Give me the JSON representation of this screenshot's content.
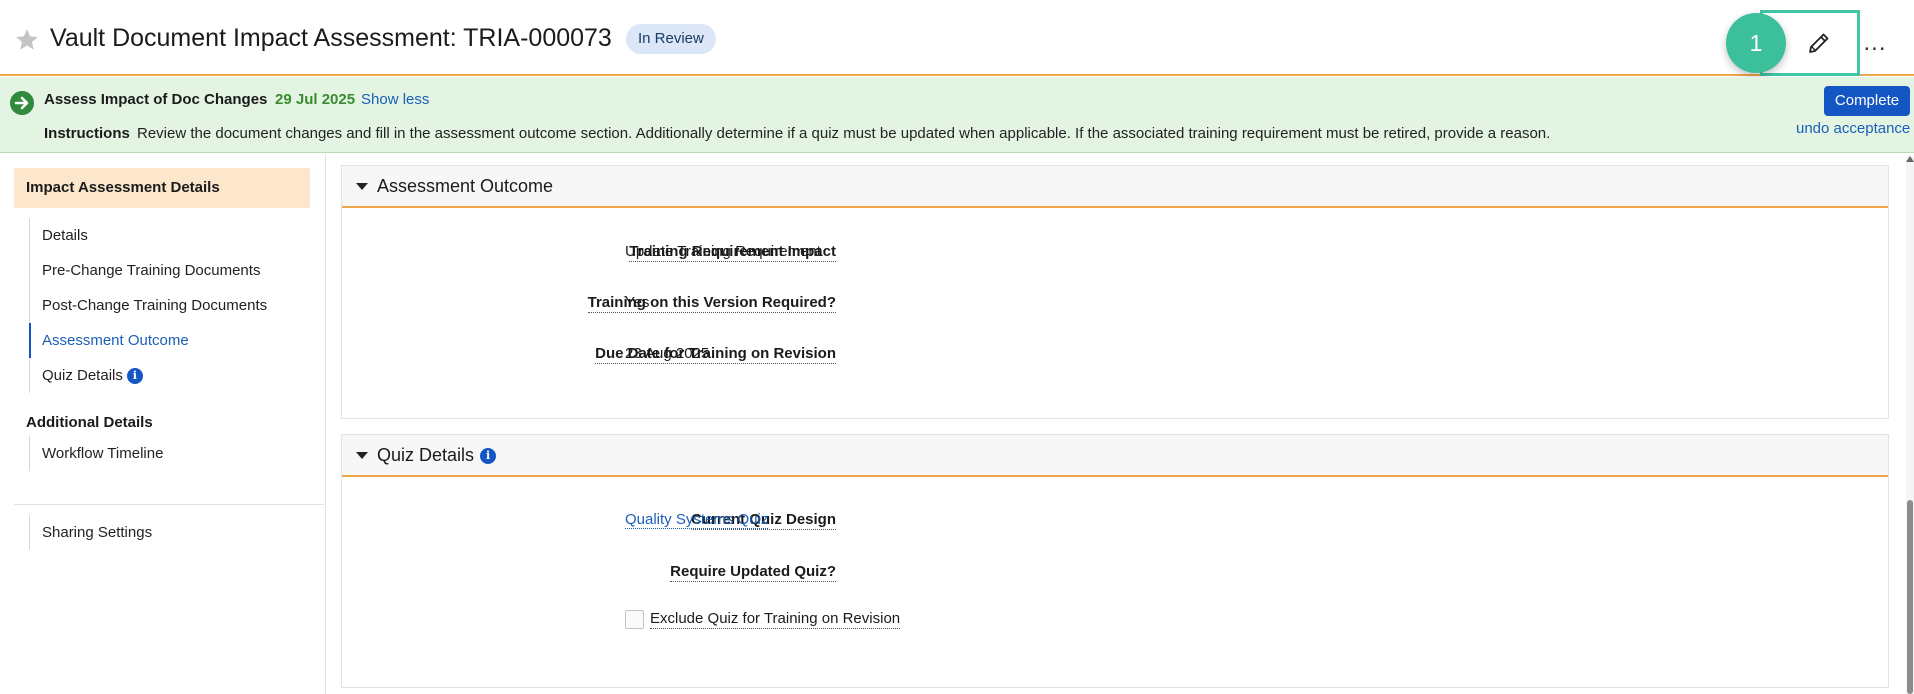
{
  "header": {
    "title": "Vault Document Impact Assessment: TRIA-000073",
    "status": "In Review",
    "step_number": "1",
    "more_label": "..."
  },
  "banner": {
    "task_name": "Assess Impact of Doc Changes",
    "due_date": "29 Jul 2025",
    "show_less": "Show less",
    "instructions_label": "Instructions",
    "instructions_text": "Review the document changes and fill in the assessment outcome section. Additionally determine if a quiz must be updated when applicable. If the associated training requirement must be retired, provide a reason.",
    "complete_label": "Complete",
    "undo_label": "undo acceptance"
  },
  "sidebar": {
    "active_section": "Impact Assessment Details",
    "items": [
      {
        "label": "Details"
      },
      {
        "label": "Pre-Change Training Documents"
      },
      {
        "label": "Post-Change Training Documents"
      },
      {
        "label": "Assessment Outcome"
      },
      {
        "label": "Quiz Details"
      }
    ],
    "additional_heading": "Additional Details",
    "additional_items": [
      {
        "label": "Workflow Timeline"
      }
    ],
    "footer_items": [
      {
        "label": "Sharing Settings"
      }
    ]
  },
  "assessment_outcome": {
    "title": "Assessment Outcome",
    "fields": [
      {
        "label": "Training Requirement Impact",
        "value": "Update Training Requirement"
      },
      {
        "label": "Training on this Version Required?",
        "value": "Yes"
      },
      {
        "label": "Due Date for Training on Revision",
        "value": "23 Aug 2025"
      }
    ]
  },
  "quiz_details": {
    "title": "Quiz Details",
    "current_quiz_label": "Current Quiz Design",
    "current_quiz_value": "Quality Systems Quiz",
    "require_updated_label": "Require Updated Quiz?",
    "exclude_label": "Exclude Quiz for Training on Revision",
    "exclude_checked": false
  },
  "colors": {
    "accent_orange": "#f0a64b",
    "banner_green": "#e4f4e3",
    "primary_blue": "#1456c4",
    "step_badge_teal": "#3cc09c"
  }
}
